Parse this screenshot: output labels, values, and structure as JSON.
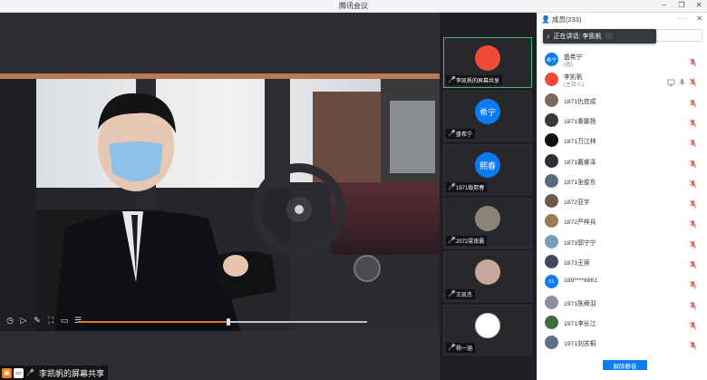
{
  "window": {
    "title": "腾讯会议"
  },
  "main": {
    "share_label": "李凯帆的屏幕共享",
    "playback_progress": 0.52
  },
  "gallery": [
    {
      "label": "李凯帆的屏幕共享",
      "avatar": "",
      "avatar_color": "#f04a3b",
      "active": true
    },
    {
      "label": "盛希宁",
      "avatar": "希宁",
      "avatar_color": "#0a7bf5",
      "active": false
    },
    {
      "label": "1971板熙春",
      "avatar": "熙春",
      "avatar_color": "#0a7bf5",
      "active": false
    },
    {
      "label": "2072梁南晨",
      "avatar": "",
      "avatar_color": "#8d8478",
      "active": false
    },
    {
      "label": "王凯杰",
      "avatar": "",
      "avatar_color": "#c7a79e",
      "active": false
    },
    {
      "label": "杨一涵",
      "avatar": "",
      "avatar_color": "#ffffff",
      "active": false
    }
  ],
  "panel": {
    "title": "成员(233)",
    "more": "···",
    "close": "✕",
    "speaking_text": "正在讲话: 李凯帆",
    "members": [
      {
        "name": "盛希宁",
        "role": "(我)",
        "avatar": "希宁",
        "color": "#0a7bf5"
      },
      {
        "name": "李凯帆",
        "role": "(主持人)",
        "avatar": "",
        "color": "#f04a3b"
      },
      {
        "name": "1871仇症成",
        "avatar": "",
        "color": "#7b6a58"
      },
      {
        "name": "1871秦娜扬",
        "avatar": "",
        "color": "#3a3a3a"
      },
      {
        "name": "1871万江林",
        "avatar": "",
        "color": "#111111"
      },
      {
        "name": "1871戴睿泽",
        "avatar": "",
        "color": "#2f2f35"
      },
      {
        "name": "1871张俊东",
        "avatar": "",
        "color": "#586b7d"
      },
      {
        "name": "1872亚宇",
        "avatar": "",
        "color": "#6d5a4a"
      },
      {
        "name": "1872严梓兵",
        "avatar": "",
        "color": "#9a7b52"
      },
      {
        "name": "1873郭宁宁",
        "avatar": "",
        "color": "#7a9bc0"
      },
      {
        "name": "1873王蓉",
        "avatar": "",
        "color": "#3f4a5a"
      },
      {
        "name": "189****8861",
        "avatar": "61",
        "color": "#0a7bf5"
      },
      {
        "name": "1971陈舜羽",
        "avatar": "",
        "color": "#8a8f99"
      },
      {
        "name": "1971李长江",
        "avatar": "",
        "color": "#3f6b3f"
      },
      {
        "name": "1971刘苏桐",
        "avatar": "",
        "color": "#5e6f8e"
      }
    ],
    "mute_all_label": "解除静音"
  },
  "colors": {
    "accent": "#0b7cf6",
    "muted": "#f15a4a",
    "active_border": "#42b983"
  }
}
